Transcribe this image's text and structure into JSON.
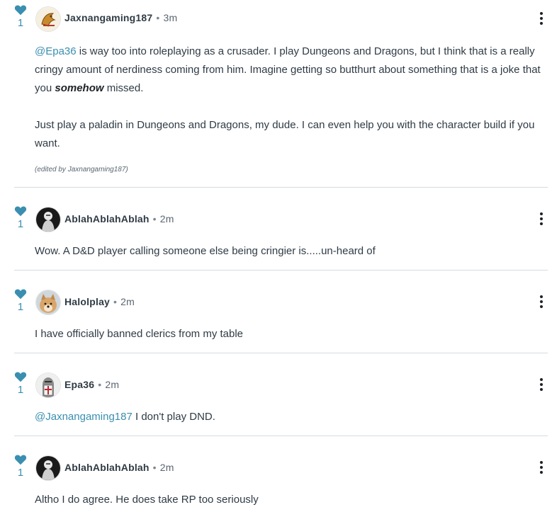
{
  "colors": {
    "accent": "#3a8fb0",
    "heart": "#3a8fb0",
    "text": "#2f3b45",
    "divider": "#d6dadd"
  },
  "comments": [
    {
      "likes": "1",
      "avatar_icon": "dragon-avatar-icon",
      "username": "Jaxnangaming187",
      "separator": "•",
      "time": "3m",
      "paragraph1": {
        "mention": "@Epa36",
        "text_a": " is way too into roleplaying as a crusader. I play Dungeons and Dragons, but I think that is a really cringy amount of nerdiness coming from him. Imagine getting so butthurt about something that is a joke that you ",
        "emphasis": "somehow",
        "text_b": " missed."
      },
      "paragraph2": "Just play a paladin in Dungeons and Dragons, my dude. I can even help you with the character build if you want.",
      "edited": "(edited by Jaxnangaming187)"
    },
    {
      "likes": "1",
      "avatar_icon": "dark-figure-avatar-icon",
      "username": "AblahAblahAblah",
      "separator": "•",
      "time": "2m",
      "text": "Wow. A D&D player calling someone else being cringier is.....un-heard of"
    },
    {
      "likes": "1",
      "avatar_icon": "dog-avatar-icon",
      "username": "Halolplay",
      "separator": "•",
      "time": "2m",
      "text": "I have officially banned clerics from my table"
    },
    {
      "likes": "1",
      "avatar_icon": "crusader-avatar-icon",
      "username": "Epa36",
      "separator": "•",
      "time": "2m",
      "mention": "@Jaxnangaming187",
      "text": " I don't play DND."
    },
    {
      "likes": "1",
      "avatar_icon": "dark-figure-avatar-icon",
      "username": "AblahAblahAblah",
      "separator": "•",
      "time": "2m",
      "text": "Altho I do agree. He does take RP too seriously"
    }
  ]
}
